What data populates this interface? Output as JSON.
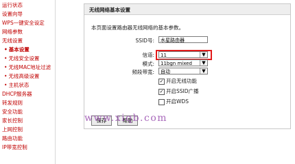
{
  "sidebar": {
    "items": [
      {
        "label": "运行状态"
      },
      {
        "label": "设置向导"
      },
      {
        "label": "WPS一键安全设定"
      },
      {
        "label": "网络参数"
      },
      {
        "label": "无线设置"
      },
      {
        "label": "基本设置"
      },
      {
        "label": "无线安全设置"
      },
      {
        "label": "无线MAC地址过滤"
      },
      {
        "label": "无线高级设置"
      },
      {
        "label": "主机状态"
      },
      {
        "label": "DHCP服务器"
      },
      {
        "label": "转发规则"
      },
      {
        "label": "安全功能"
      },
      {
        "label": "家长控制"
      },
      {
        "label": "上网控制"
      },
      {
        "label": "路由功能"
      },
      {
        "label": "IP带宽控制"
      }
    ]
  },
  "panel": {
    "title": "无线网络基本设置",
    "description": "本页面设置路由器无线网络的基本参数。",
    "fields": {
      "ssid": {
        "label": "SSID号:",
        "value": "水星路由器"
      },
      "channel": {
        "label": "信道:",
        "value": "11"
      },
      "mode": {
        "label": "模式:",
        "value": "11bgn mixed"
      },
      "bandwidth": {
        "label": "频段带宽:",
        "value": "自动"
      }
    },
    "checks": {
      "wireless": {
        "label": "开启无线功能",
        "checked": true
      },
      "ssid_broadcast": {
        "label": "开启SSID广播",
        "checked": true
      },
      "wds": {
        "label": "开启WDS",
        "checked": false
      }
    },
    "buttons": {
      "save": "保存",
      "help": "帮助"
    }
  },
  "watermark": "www.xiqb.com",
  "colors": {
    "sidebar_text": "#c00000",
    "highlight": "#e21a1a"
  }
}
